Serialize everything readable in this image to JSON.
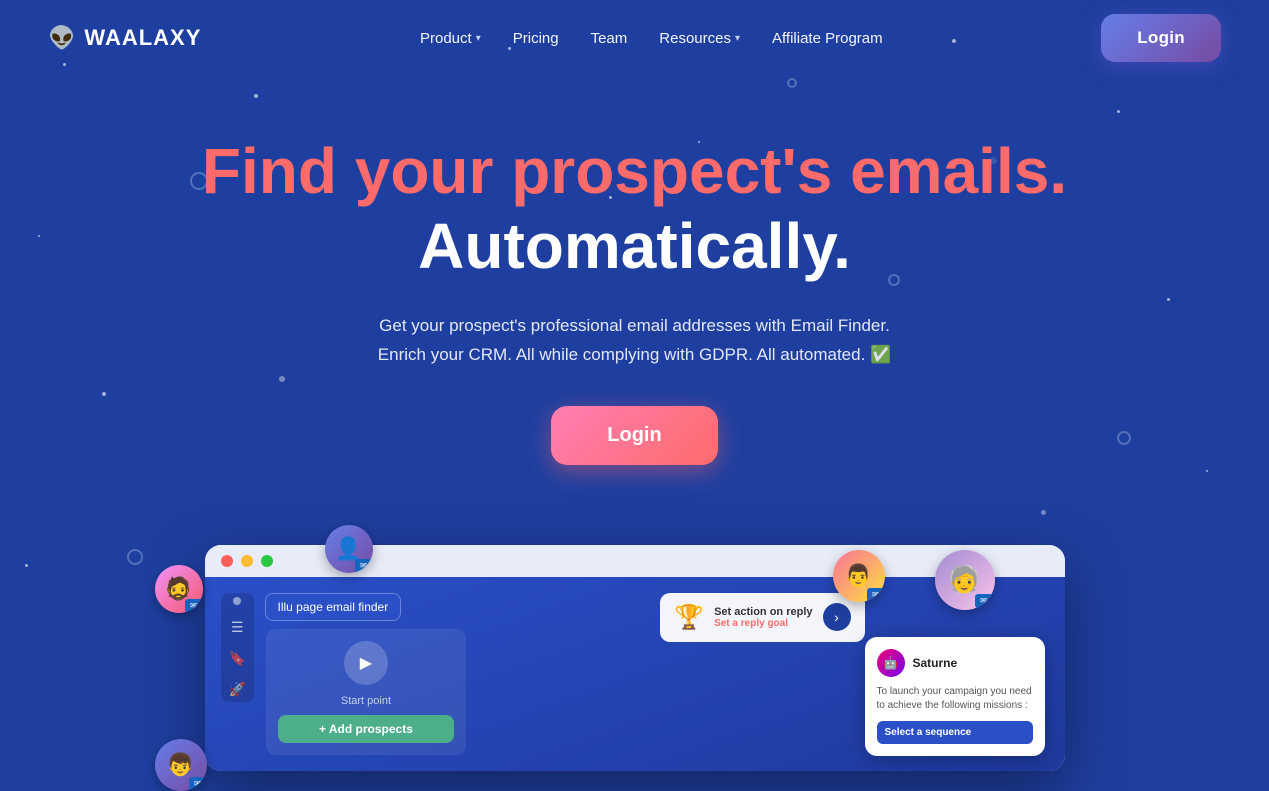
{
  "brand": {
    "name": "WAALAXY",
    "logo_icon": "👽"
  },
  "nav": {
    "links": [
      {
        "label": "Product",
        "has_dropdown": true
      },
      {
        "label": "Pricing",
        "has_dropdown": false
      },
      {
        "label": "Team",
        "has_dropdown": false
      },
      {
        "label": "Resources",
        "has_dropdown": true
      },
      {
        "label": "Affiliate Program",
        "has_dropdown": false
      }
    ],
    "login_label": "Login"
  },
  "hero": {
    "title_line1": "Find your prospect's emails.",
    "title_line2": "Automatically.",
    "subtitle_line1": "Get your prospect's professional email addresses with Email Finder.",
    "subtitle_line2": "Enrich your CRM. All while complying with GDPR. All automated. ✅",
    "cta_label": "Login"
  },
  "app_preview": {
    "illu_tag": "Illu page email finder",
    "play_button_label": "▶",
    "start_point": "Start point",
    "add_prospects_label": "+ Add prospects",
    "trophy_card": {
      "icon": "🏆",
      "main_text": "Set action on reply",
      "sub_text": "Set a reply goal"
    },
    "saturne_card": {
      "name": "Saturne",
      "description": "To launch your campaign you need to achieve the following missions :",
      "action_label": "Select a sequence"
    }
  },
  "background": {
    "base_color": "#1e3fa0",
    "accent_color": "#2a54d4"
  }
}
